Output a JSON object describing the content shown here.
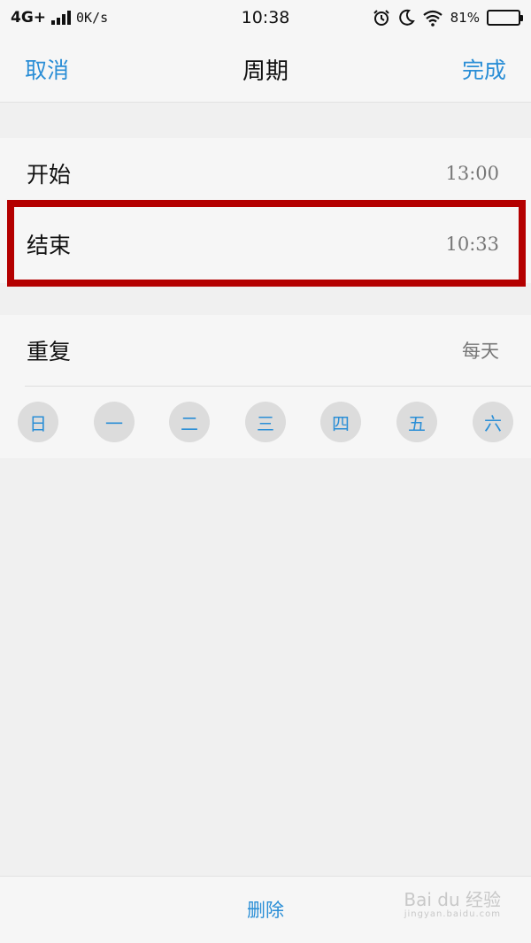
{
  "status_bar": {
    "network": "4G+",
    "speed": "0K/s",
    "time": "10:38",
    "battery_text": "81%",
    "battery_level": 0.81,
    "icons": [
      "alarm-icon",
      "moon-icon",
      "wifi-icon",
      "battery-icon",
      "signal-icon"
    ]
  },
  "nav": {
    "cancel": "取消",
    "title": "周期",
    "done": "完成"
  },
  "schedule": {
    "start_label": "开始",
    "start_value": "13:00",
    "end_label": "结束",
    "end_value": "10:33"
  },
  "repeat": {
    "label": "重复",
    "value": "每天",
    "days": [
      "日",
      "一",
      "二",
      "三",
      "四",
      "五",
      "六"
    ]
  },
  "footer": {
    "delete": "删除"
  },
  "watermark": {
    "brand": "Bai du 经验",
    "url": "jingyan.baidu.com"
  },
  "colors": {
    "accent": "#2a8ed6",
    "highlight": "#b40000"
  }
}
